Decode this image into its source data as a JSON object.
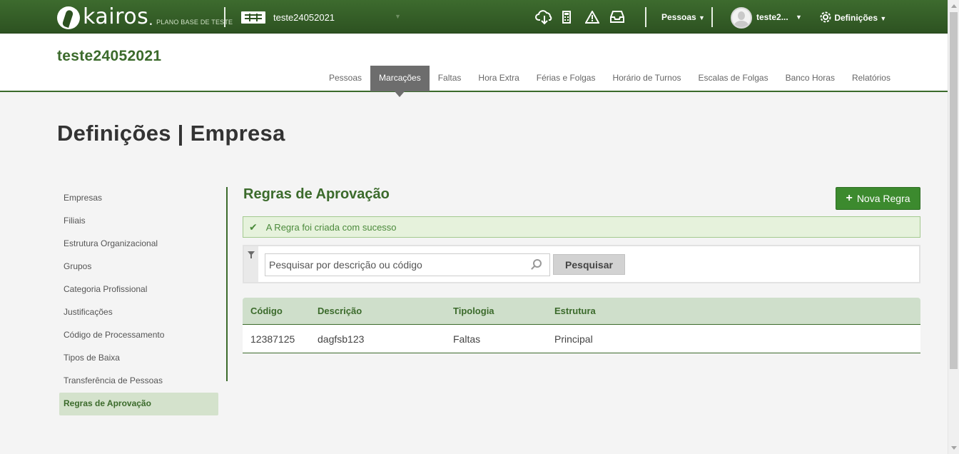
{
  "topbar": {
    "logo_text": "kairos",
    "logo_dot": ".",
    "logo_sub": "PLANO BASE DE TESTE",
    "company_selector": "teste24052021",
    "people_menu": "Pessoas",
    "user_name": "teste2...",
    "settings_menu": "Definições"
  },
  "header": {
    "company_title": "teste24052021",
    "nav": [
      {
        "label": "Pessoas"
      },
      {
        "label": "Marcações",
        "active": true
      },
      {
        "label": "Faltas"
      },
      {
        "label": "Hora Extra"
      },
      {
        "label": "Férias e Folgas"
      },
      {
        "label": "Horário de Turnos"
      },
      {
        "label": "Escalas de Folgas"
      },
      {
        "label": "Banco Horas"
      },
      {
        "label": "Relatórios"
      }
    ]
  },
  "page": {
    "title": "Definições | Empresa"
  },
  "sidemenu": {
    "items": [
      {
        "label": "Empresas"
      },
      {
        "label": "Filiais"
      },
      {
        "label": "Estrutura Organizacional"
      },
      {
        "label": "Grupos"
      },
      {
        "label": "Categoria Profissional"
      },
      {
        "label": "Justificações"
      },
      {
        "label": "Código de Processamento"
      },
      {
        "label": "Tipos de Baixa"
      },
      {
        "label": "Transferência de Pessoas"
      },
      {
        "label": "Regras de Aprovação",
        "active": true
      }
    ]
  },
  "main": {
    "section_title": "Regras de Aprovação",
    "new_button": "Nova Regra",
    "alert_message": "A Regra foi criada com sucesso",
    "search": {
      "placeholder": "Pesquisar por descrição ou código",
      "value": "",
      "button": "Pesquisar"
    },
    "table": {
      "headers": [
        "Código",
        "Descrição",
        "Tipologia",
        "Estrutura"
      ],
      "rows": [
        [
          "12387125",
          "dagfsb123",
          "Faltas",
          "Principal"
        ]
      ]
    }
  },
  "colors": {
    "brand_green": "#3b6a2b",
    "topbar_green": "#2d5221",
    "button_green": "#3c8a2e",
    "nav_active_bg": "#6d6d6d",
    "alert_bg": "#e6f2dc"
  },
  "icons": {
    "topbar": [
      "cloud-download-icon",
      "calculator-icon",
      "warning-icon",
      "inbox-icon",
      "gear-icon"
    ],
    "search": [
      "filter-icon",
      "search-icon"
    ],
    "alert": "checkmark-icon"
  }
}
